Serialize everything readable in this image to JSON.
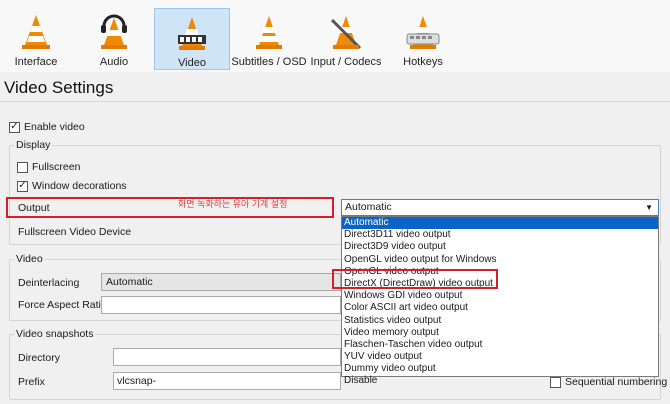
{
  "toolbar": {
    "items": [
      {
        "label": "Interface"
      },
      {
        "label": "Audio"
      },
      {
        "label": "Video"
      },
      {
        "label": "Subtitles / OSD"
      },
      {
        "label": "Input / Codecs"
      },
      {
        "label": "Hotkeys"
      }
    ]
  },
  "page_title": "Video Settings",
  "enable_video": {
    "label": "Enable video",
    "checked": true
  },
  "display": {
    "title": "Display",
    "fullscreen": {
      "label": "Fullscreen",
      "checked": false
    },
    "window_decorations": {
      "label": "Window decorations",
      "checked": true
    },
    "output_label": "Output",
    "output_value": "Automatic",
    "fullscreen_device_label": "Fullscreen Video Device",
    "annotation": "화면 녹화하는 유아 기계 설정"
  },
  "output_options": [
    "Automatic",
    "Direct3D11 video output",
    "Direct3D9 video output",
    "OpenGL video output for Windows",
    "OpenGL video output",
    "DirectX (DirectDraw) video output",
    "Windows GDI video output",
    "Color ASCII art video output",
    "Statistics video output",
    "Video memory output",
    "Flaschen-Taschen video output",
    "YUV video output",
    "Dummy video output",
    "Disable"
  ],
  "video": {
    "title": "Video",
    "deinterlacing_label": "Deinterlacing",
    "deinterlacing_value": "Automatic",
    "aspect_label": "Force Aspect Ratio"
  },
  "snapshots": {
    "title": "Video snapshots",
    "directory_label": "Directory",
    "prefix_label": "Prefix",
    "prefix_value": "vlcsnap-",
    "sequential_label": "Sequential numbering"
  },
  "colors": {
    "selection": "#0a64c8",
    "highlight": "#d61f2a",
    "active_tab": "#cfe4f7"
  }
}
